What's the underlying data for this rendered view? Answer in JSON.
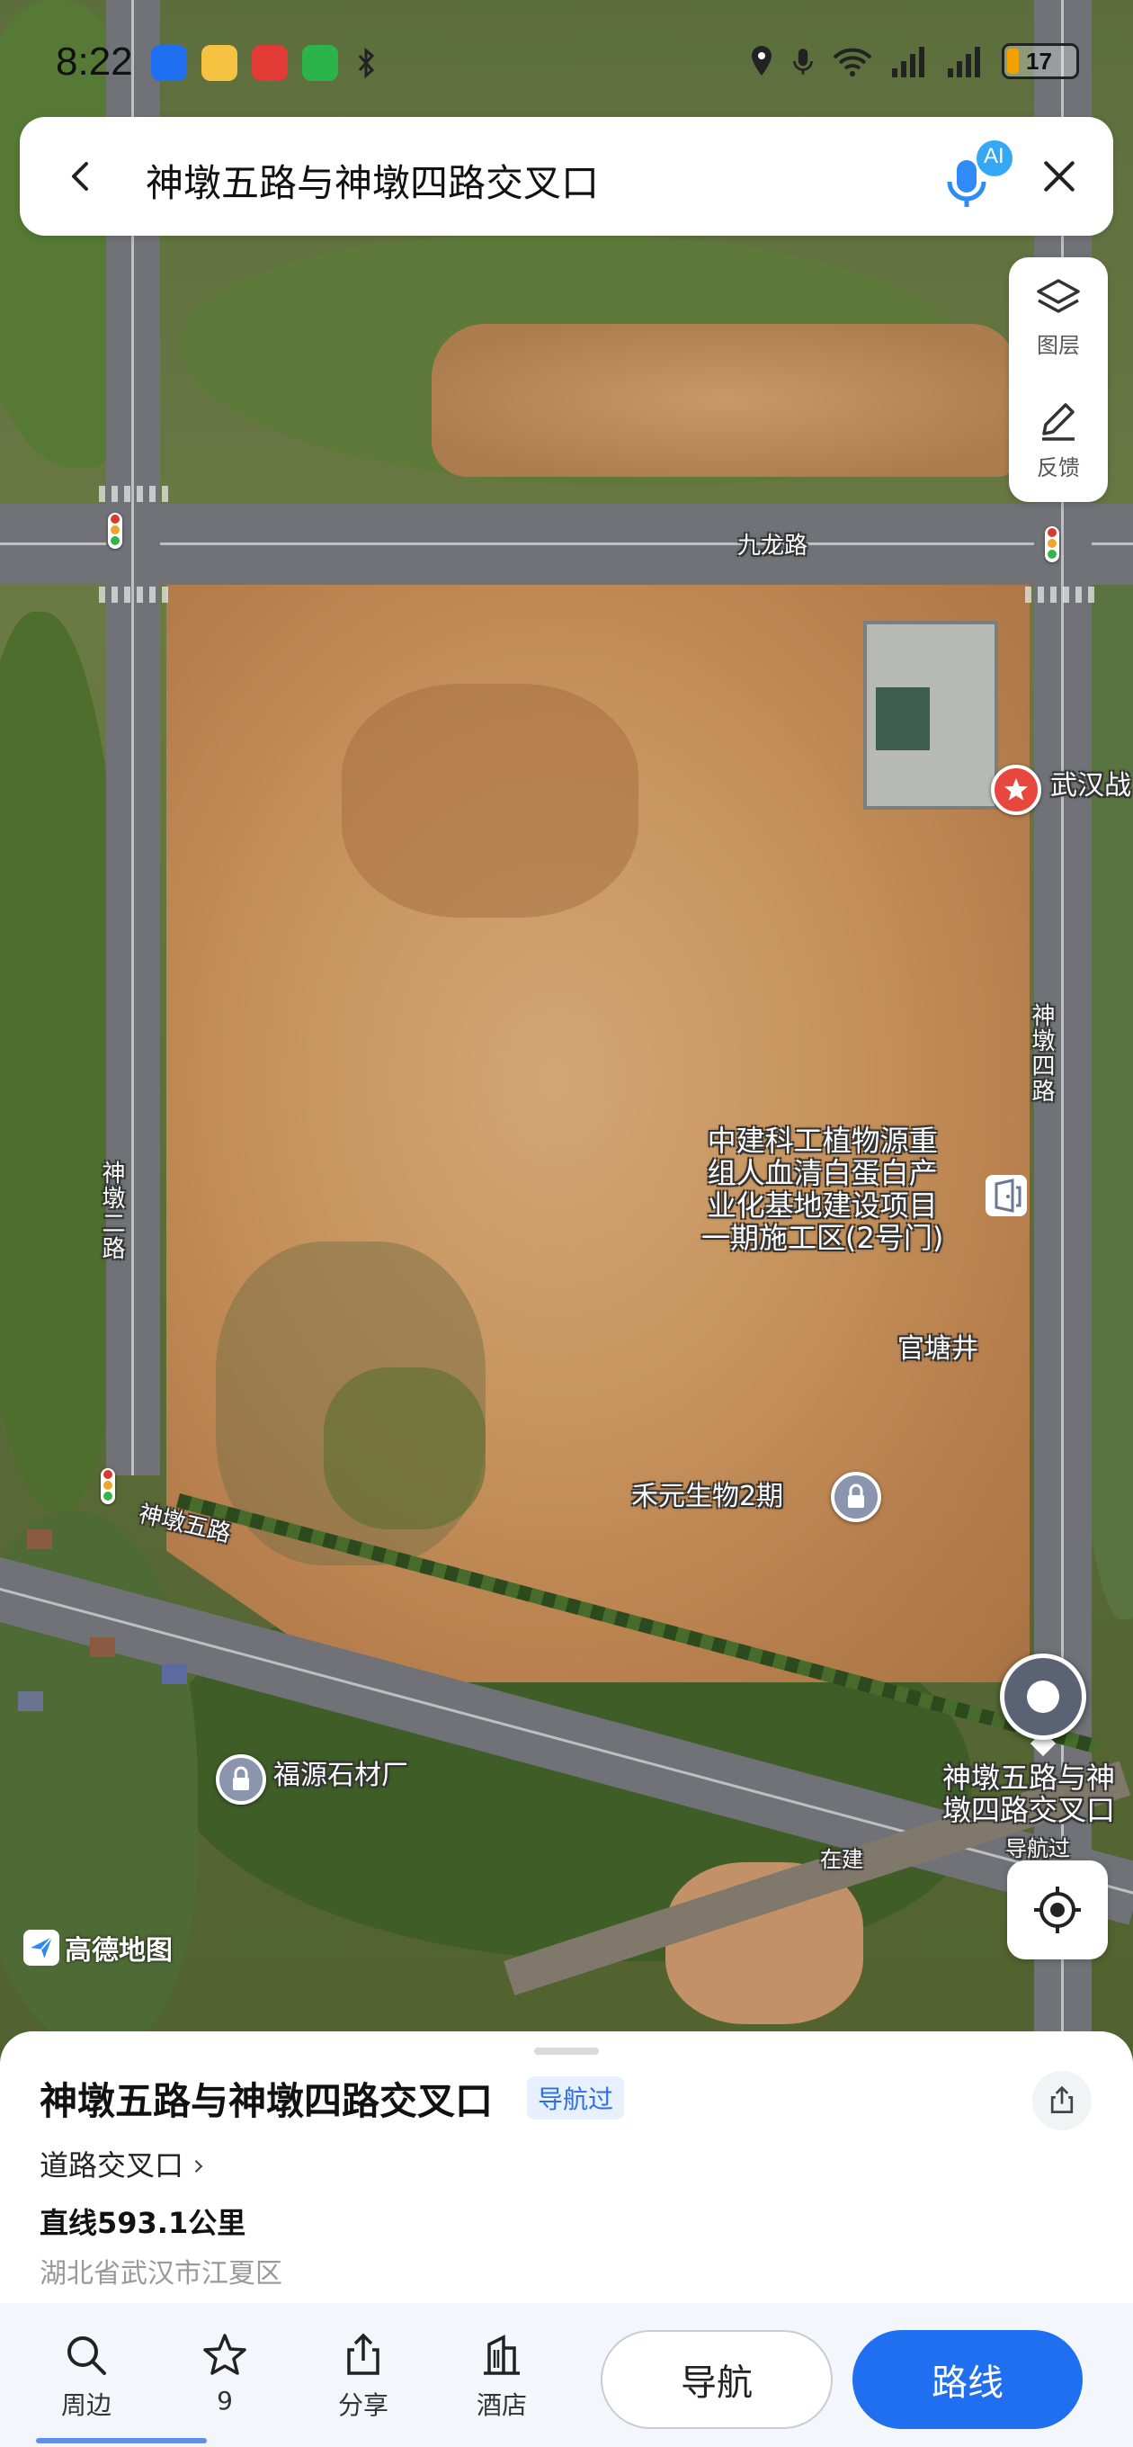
{
  "status_bar": {
    "time": "8:22",
    "battery_level": "17",
    "battery_percent": 17
  },
  "search": {
    "query": "神墩五路与神墩四路交叉口",
    "ai_badge": "AI"
  },
  "map_tools": {
    "layers_label": "图层",
    "feedback_label": "反馈"
  },
  "map_labels": {
    "jiulong_road": "九龙路",
    "wuhan_poi": "武汉战",
    "shendun_4": "神墩四路",
    "shendun_2": "神墩二路",
    "project": "中建科工植物源重\n组人血清白蛋白产\n业化基地建设项目\n一期施工区(2号门)",
    "guantangjing": "官塘井",
    "heyuan": "禾元生物2期",
    "shendun_5": "神墩五路",
    "fuyuan": "福源石材厂",
    "pin_label": "神墩五路与神\n墩四路交叉口",
    "pin_sub": "导航过",
    "zaijian": "在建",
    "logo": "高德地图"
  },
  "place": {
    "title": "神墩五路与神墩四路交叉口",
    "badge": "导航过",
    "category": "道路交叉口",
    "distance": "直线593.1公里",
    "address": "湖北省武汉市江夏区"
  },
  "actions": {
    "nearby": "周边",
    "favorites_count": "9",
    "share": "分享",
    "hotel": "酒店",
    "navigate": "导航",
    "route": "路线"
  },
  "colors": {
    "accent": "#1f6ff0",
    "poi_red": "#e8473d",
    "badge_text": "#2f6fe0"
  },
  "icons": [
    "back-arrow-icon",
    "voice-ai-icon",
    "close-icon",
    "layers-icon",
    "feedback-pen-icon",
    "locate-icon",
    "share-icon",
    "search-icon",
    "star-icon",
    "hotel-icon",
    "location-pin-icon",
    "traffic-light-icon"
  ]
}
